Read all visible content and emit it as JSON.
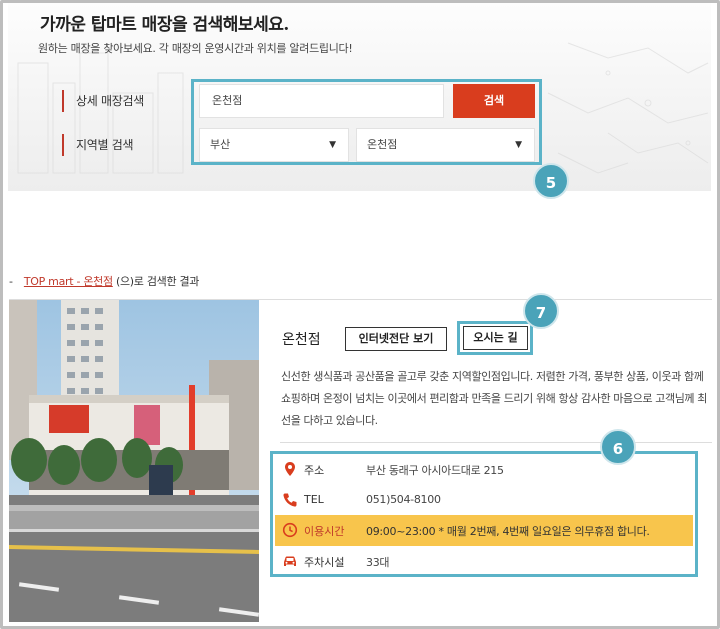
{
  "search": {
    "headline": "가까운 탑마트 매장을 검색해보세요.",
    "subline": "원하는 매장을 찾아보세요. 각 매장의 운영시간과 위치를 알려드립니다!",
    "detail_label": "상세 매장검색",
    "region_label": "지역별 검색",
    "keyword_value": "온천점",
    "button_label": "검색",
    "region_value": "부산",
    "store_value": "온천점",
    "badge": "5"
  },
  "result": {
    "prefix": "-",
    "link_text": "TOP mart - 온천점",
    "suffix": "(으)로 검색한 결과"
  },
  "store": {
    "name": "온천점",
    "inside_button": "인터넷전단 보기",
    "directions_button": "오시는 길",
    "badge_directions": "7",
    "badge_info": "6",
    "description": "신선한 생식품과 공산품을 골고루 갖춘 지역할인점입니다. 저렴한 가격, 풍부한 상품, 이웃과 함께 쇼핑하며 온정이 넘치는 이곳에서 편리함과 만족을 드리기 위해 항상 감사한 마음으로 고객님께 최선을 다하고 있습니다.",
    "info": [
      {
        "icon": "location-pin-icon",
        "label": "주소",
        "value": "부산 동래구 아시아드대로 215"
      },
      {
        "icon": "phone-icon",
        "label": "TEL",
        "value": "051)504-8100"
      },
      {
        "icon": "clock-icon",
        "label": "이용시간",
        "value": "09:00~23:00 * 매월 2번째, 4번째 일요일은 의무휴점 합니다."
      },
      {
        "icon": "car-icon",
        "label": "주차시설",
        "value": "33대"
      }
    ]
  },
  "colors": {
    "accent_red": "#d93d1e",
    "highlight_blue": "#5bb3c8",
    "badge_blue": "#4aa3b9",
    "hours_yellow": "#f8c54c"
  }
}
